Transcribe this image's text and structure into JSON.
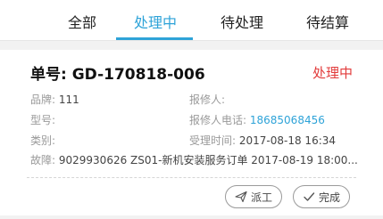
{
  "tabs": [
    {
      "label": "全部"
    },
    {
      "label": "处理中"
    },
    {
      "label": "待处理"
    },
    {
      "label": "待结算"
    }
  ],
  "active_tab_index": 1,
  "colors": {
    "accent": "#2ea3d8",
    "status": "#e23b3b"
  },
  "order": {
    "title": "单号: GD-170818-006",
    "status": "处理中",
    "brand_label": "品牌:",
    "brand_value": "111",
    "model_label": "型号:",
    "model_value": "",
    "category_label": "类别:",
    "category_value": "",
    "fault_label": "故障:",
    "fault_value": "9029930626 ZS01-新机安装服务订单 2017-08-19 18:00...",
    "reporter_label": "报修人:",
    "reporter_value": "",
    "phone_label": "报修人电话:",
    "phone_value": "18685068456",
    "accept_time_label": "受理时间:",
    "accept_time_value": "2017-08-18 16:34"
  },
  "actions": {
    "dispatch_label": "派工",
    "dispatch_icon": "send-icon",
    "complete_label": "完成",
    "complete_icon": "check-icon"
  }
}
